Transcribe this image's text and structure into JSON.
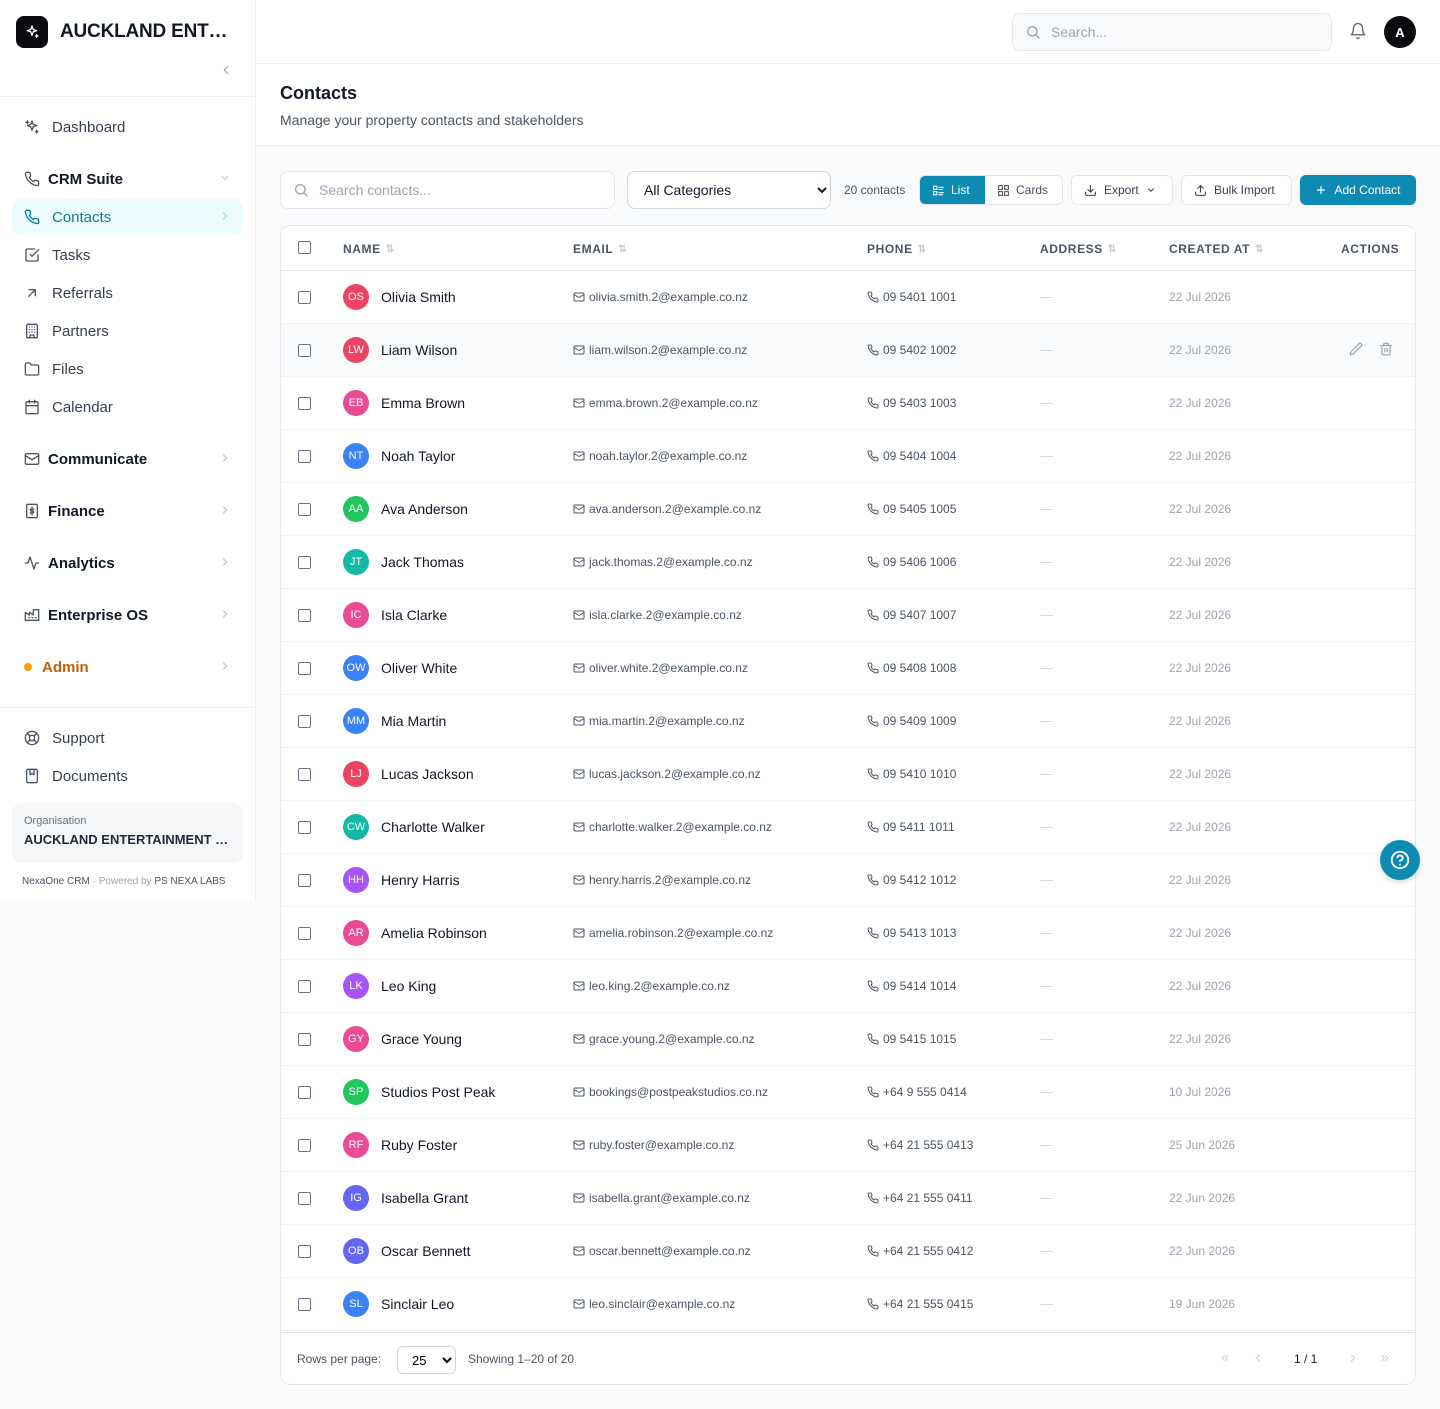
{
  "brand": {
    "name": "AUCKLAND ENTERTAINMENT CO."
  },
  "nav": {
    "dashboard": "Dashboard",
    "crm_suite": "CRM Suite",
    "contacts": "Contacts",
    "tasks": "Tasks",
    "referrals": "Referrals",
    "partners": "Partners",
    "files": "Files",
    "calendar": "Calendar",
    "communicate": "Communicate",
    "finance": "Finance",
    "analytics": "Analytics",
    "enterprise_os": "Enterprise OS",
    "admin": "Admin",
    "support": "Support",
    "documents": "Documents"
  },
  "org": {
    "label": "Organisation",
    "name": "AUCKLAND ENTERTAINMENT CO."
  },
  "footer_brand": {
    "product": "NexaOne CRM",
    "sep": "·",
    "powered_by": "Powered by",
    "company": "PS NEXA LABS"
  },
  "topbar": {
    "search_placeholder": "Search...",
    "avatar_initial": "A"
  },
  "page": {
    "title": "Contacts",
    "subtitle": "Manage your property contacts and stakeholders"
  },
  "toolbar": {
    "search_placeholder": "Search contacts...",
    "category_selected": "All Categories",
    "count": "20 contacts",
    "list_label": "List",
    "cards_label": "Cards",
    "export_label": "Export",
    "bulk_import_label": "Bulk Import",
    "add_label": "Add Contact"
  },
  "columns": {
    "name": "NAME",
    "email": "EMAIL",
    "phone": "PHONE",
    "address": "ADDRESS",
    "created": "CREATED AT",
    "actions": "ACTIONS"
  },
  "empty_value": "—",
  "avatar_colors": {
    "rose": "#ec4463",
    "pink": "#e94b95",
    "blue": "#3b82f6",
    "green": "#22c55e",
    "teal": "#14b8a6",
    "purple": "#a855f7",
    "indigo": "#6366f1"
  },
  "contacts": [
    {
      "initials": "OS",
      "name": "Olivia Smith",
      "email": "olivia.smith.2@example.co.nz",
      "phone": "09 5401 1001",
      "created": "22 Jul 2026",
      "color": "rose"
    },
    {
      "initials": "LW",
      "name": "Liam Wilson",
      "email": "liam.wilson.2@example.co.nz",
      "phone": "09 5402 1002",
      "created": "22 Jul 2026",
      "color": "rose"
    },
    {
      "initials": "EB",
      "name": "Emma Brown",
      "email": "emma.brown.2@example.co.nz",
      "phone": "09 5403 1003",
      "created": "22 Jul 2026",
      "color": "pink"
    },
    {
      "initials": "NT",
      "name": "Noah Taylor",
      "email": "noah.taylor.2@example.co.nz",
      "phone": "09 5404 1004",
      "created": "22 Jul 2026",
      "color": "blue"
    },
    {
      "initials": "AA",
      "name": "Ava Anderson",
      "email": "ava.anderson.2@example.co.nz",
      "phone": "09 5405 1005",
      "created": "22 Jul 2026",
      "color": "green"
    },
    {
      "initials": "JT",
      "name": "Jack Thomas",
      "email": "jack.thomas.2@example.co.nz",
      "phone": "09 5406 1006",
      "created": "22 Jul 2026",
      "color": "teal"
    },
    {
      "initials": "IC",
      "name": "Isla Clarke",
      "email": "isla.clarke.2@example.co.nz",
      "phone": "09 5407 1007",
      "created": "22 Jul 2026",
      "color": "pink"
    },
    {
      "initials": "OW",
      "name": "Oliver White",
      "email": "oliver.white.2@example.co.nz",
      "phone": "09 5408 1008",
      "created": "22 Jul 2026",
      "color": "blue"
    },
    {
      "initials": "MM",
      "name": "Mia Martin",
      "email": "mia.martin.2@example.co.nz",
      "phone": "09 5409 1009",
      "created": "22 Jul 2026",
      "color": "blue"
    },
    {
      "initials": "LJ",
      "name": "Lucas Jackson",
      "email": "lucas.jackson.2@example.co.nz",
      "phone": "09 5410 1010",
      "created": "22 Jul 2026",
      "color": "rose"
    },
    {
      "initials": "CW",
      "name": "Charlotte Walker",
      "email": "charlotte.walker.2@example.co.nz",
      "phone": "09 5411 1011",
      "created": "22 Jul 2026",
      "color": "teal"
    },
    {
      "initials": "HH",
      "name": "Henry Harris",
      "email": "henry.harris.2@example.co.nz",
      "phone": "09 5412 1012",
      "created": "22 Jul 2026",
      "color": "purple"
    },
    {
      "initials": "AR",
      "name": "Amelia Robinson",
      "email": "amelia.robinson.2@example.co.nz",
      "phone": "09 5413 1013",
      "created": "22 Jul 2026",
      "color": "pink"
    },
    {
      "initials": "LK",
      "name": "Leo King",
      "email": "leo.king.2@example.co.nz",
      "phone": "09 5414 1014",
      "created": "22 Jul 2026",
      "color": "purple"
    },
    {
      "initials": "GY",
      "name": "Grace Young",
      "email": "grace.young.2@example.co.nz",
      "phone": "09 5415 1015",
      "created": "22 Jul 2026",
      "color": "pink"
    },
    {
      "initials": "SP",
      "name": "Studios Post Peak",
      "email": "bookings@postpeakstudios.co.nz",
      "phone": "+64 9 555 0414",
      "created": "10 Jul 2026",
      "color": "green"
    },
    {
      "initials": "RF",
      "name": "Ruby Foster",
      "email": "ruby.foster@example.co.nz",
      "phone": "+64 21 555 0413",
      "created": "25 Jun 2026",
      "color": "pink"
    },
    {
      "initials": "IG",
      "name": "Isabella Grant",
      "email": "isabella.grant@example.co.nz",
      "phone": "+64 21 555 0411",
      "created": "22 Jun 2026",
      "color": "indigo"
    },
    {
      "initials": "OB",
      "name": "Oscar Bennett",
      "email": "oscar.bennett@example.co.nz",
      "phone": "+64 21 555 0412",
      "created": "22 Jun 2026",
      "color": "indigo"
    },
    {
      "initials": "SL",
      "name": "Sinclair Leo",
      "email": "leo.sinclair@example.co.nz",
      "phone": "+64 21 555 0415",
      "created": "19 Jun 2026",
      "color": "blue"
    }
  ],
  "hovered_row": 1,
  "pagination": {
    "rows_label": "Rows per page:",
    "rows_value": "25",
    "showing": "Showing 1–20 of 20",
    "page": "1 / 1"
  }
}
